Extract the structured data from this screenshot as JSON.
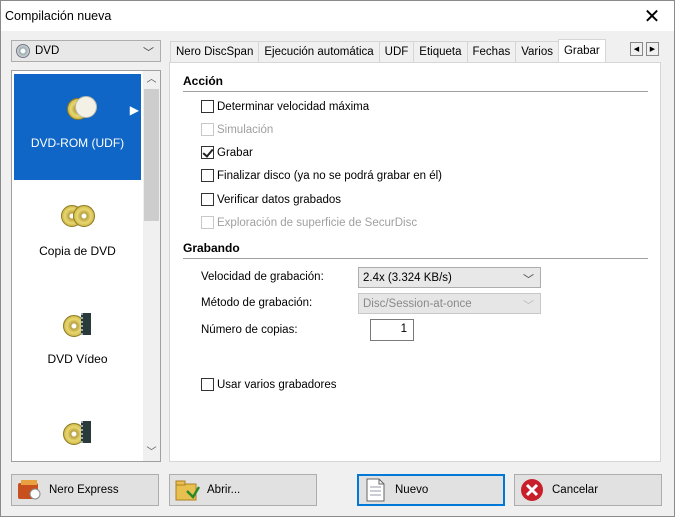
{
  "window": {
    "title": "Compilación nueva"
  },
  "disc_type": {
    "selected": "DVD"
  },
  "projects": [
    {
      "label": "DVD-ROM (UDF)"
    },
    {
      "label": "Copia de DVD"
    },
    {
      "label": "DVD Vídeo"
    },
    {
      "label": ""
    }
  ],
  "tabs": [
    "Nero DiscSpan",
    "Ejecución automática",
    "UDF",
    "Etiqueta",
    "Fechas",
    "Varios",
    "Grabar"
  ],
  "active_tab": "Grabar",
  "accion": {
    "heading": "Acción",
    "options": [
      {
        "label": "Determinar velocidad máxima",
        "checked": false,
        "enabled": true
      },
      {
        "label": "Simulación",
        "checked": false,
        "enabled": false
      },
      {
        "label": "Grabar",
        "checked": true,
        "enabled": true
      },
      {
        "label": "Finalizar disco (ya no se podrá grabar en él)",
        "checked": false,
        "enabled": true
      },
      {
        "label": "Verificar datos grabados",
        "checked": false,
        "enabled": true
      },
      {
        "label": "Exploración de superficie de SecurDisc",
        "checked": false,
        "enabled": false
      }
    ]
  },
  "grabando": {
    "heading": "Grabando",
    "speed_label": "Velocidad de grabación:",
    "speed_value": "2.4x (3.324 KB/s)",
    "method_label": "Método de grabación:",
    "method_value": "Disc/Session-at-once",
    "copies_label": "Número de copias:",
    "copies_value": "1",
    "multi_label": "Usar varios grabadores"
  },
  "buttons": {
    "nero_express": "Nero Express",
    "abrir": "Abrir...",
    "nuevo": "Nuevo",
    "cancelar": "Cancelar"
  },
  "icons": {
    "close": "close-icon",
    "chevron": "chevron-down-icon",
    "scroll_up": "chevron-up-icon",
    "scroll_down": "chevron-down-icon",
    "tab_prev": "triangle-left-icon",
    "tab_next": "triangle-right-icon"
  }
}
